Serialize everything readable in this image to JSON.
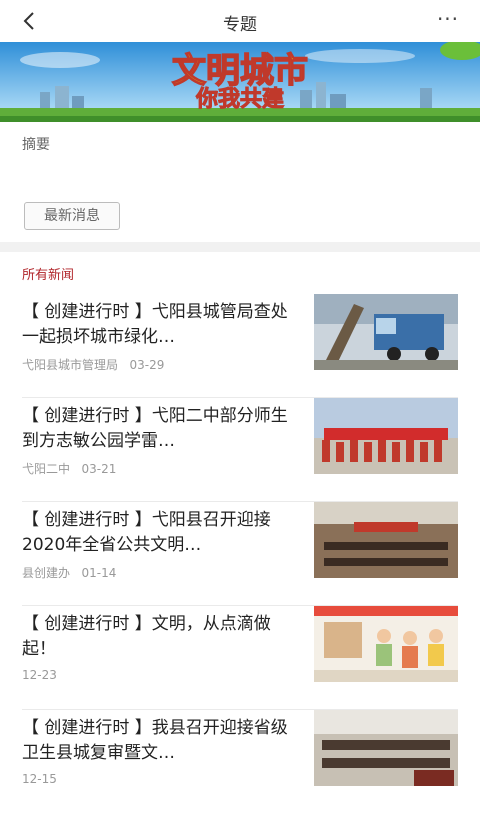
{
  "header": {
    "title": "专题",
    "back_icon": "chevron-left-icon",
    "more_icon": "more-dots-icon",
    "more_glyph": "···"
  },
  "banner": {
    "line1": "文明城市",
    "line2": "你我共建"
  },
  "summary": {
    "label": "摘要"
  },
  "latest_button": {
    "label": "最新消息"
  },
  "section": {
    "title": "所有新闻",
    "color": "#b1262b"
  },
  "news": [
    {
      "headline": "【 创建进行时 】弋阳县城管局查处一起损坏城市绿化…",
      "source": "弋阳县城市管理局",
      "date": "03-29"
    },
    {
      "headline": "【 创建进行时 】弋阳二中部分师生到方志敏公园学雷…",
      "source": "弋阳二中",
      "date": "03-21"
    },
    {
      "headline": "【 创建进行时 】弋阳县召开迎接2020年全省公共文明…",
      "source": "县创建办",
      "date": "01-14"
    },
    {
      "headline": "【 创建进行时 】文明，从点滴做起！",
      "source": "",
      "date": "12-23"
    },
    {
      "headline": "【 创建进行时 】我县召开迎接省级卫生县城复审暨文…",
      "source": "",
      "date": "12-15"
    }
  ]
}
